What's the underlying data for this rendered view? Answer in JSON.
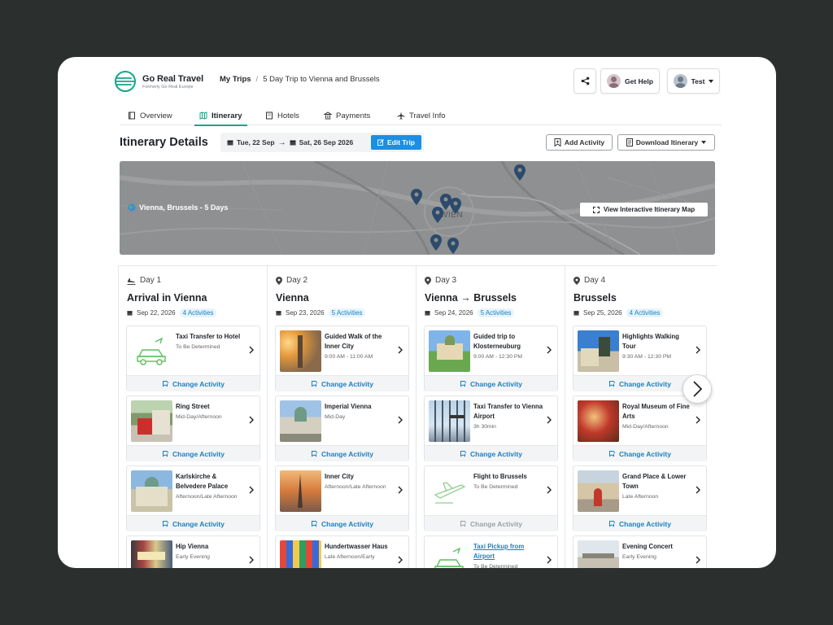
{
  "brand": {
    "name": "Go Real Travel",
    "tagline": "Formerly Go Real Europe",
    "accent": "#17a589"
  },
  "breadcrumb": {
    "root": "My Trips",
    "separator": "/",
    "current": "5 Day Trip to Vienna and Brussels"
  },
  "header": {
    "help_label": "Get Help",
    "user_label": "Test"
  },
  "tabs": [
    {
      "label": "Overview",
      "icon": "book-icon"
    },
    {
      "label": "Itinerary",
      "icon": "map-icon",
      "active": true
    },
    {
      "label": "Hotels",
      "icon": "building-icon"
    },
    {
      "label": "Payments",
      "icon": "bank-icon"
    },
    {
      "label": "Travel Info",
      "icon": "plane-icon"
    }
  ],
  "itinerary": {
    "title": "Itinerary Details",
    "start_date": "Tue, 22 Sep",
    "end_date": "Sat, 26 Sep 2026",
    "edit_label": "Edit Trip",
    "add_label": "Add Activity",
    "download_label": "Download Itinerary"
  },
  "map": {
    "label": "Vienna, Brussels - 5 Days",
    "city_text": "WIEN",
    "button_label": "View Interactive Itinerary Map"
  },
  "change_label": "Change Activity",
  "days": [
    {
      "day": "Day 1",
      "title": "Arrival in Vienna",
      "date": "Sep 22, 2026",
      "count": "4 Activities",
      "activities": [
        {
          "name": "Taxi Transfer to Hotel",
          "time": "To Be Determined",
          "thumb": "car-icon"
        },
        {
          "name": "Ring Street",
          "time": "Mid-Day/Afternoon",
          "thumb": "tram-photo"
        },
        {
          "name": "Karlskirche & Belvedere Palace",
          "time": "Afternoon/Late Afternoon",
          "thumb": "church-photo"
        },
        {
          "name": "Hip Vienna",
          "time": "Early Evening",
          "thumb": "street-photo"
        }
      ]
    },
    {
      "day": "Day 2",
      "title": "Vienna",
      "date": "Sep 23, 2026",
      "count": "5 Activities",
      "activities": [
        {
          "name": "Guided Walk of the Inner City",
          "time": "9:00 AM - 11:00 AM",
          "thumb": "city-photo"
        },
        {
          "name": "Imperial Vienna",
          "time": "Mid-Day",
          "thumb": "palace-photo"
        },
        {
          "name": "Inner City",
          "time": "Afternoon/Late Afternoon",
          "thumb": "cathedral-photo"
        },
        {
          "name": "Hundertwasser Haus",
          "time": "Late Afternoon/Early",
          "thumb": "colorful-photo"
        }
      ]
    },
    {
      "day": "Day 3",
      "title": "Vienna → Brussels",
      "date": "Sep 24, 2026",
      "count": "5 Activities",
      "activities": [
        {
          "name": "Guided trip to Klosterneuburg",
          "time": "9:00 AM - 12:30 PM",
          "thumb": "abbey-photo"
        },
        {
          "name": "Taxi Transfer to Vienna Airport",
          "time": "3h 30min",
          "thumb": "airport-photo"
        },
        {
          "name": "Flight to Brussels",
          "time": "To Be Determined",
          "thumb": "plane-icon",
          "disabled": true
        },
        {
          "name": "Taxi Pickup from Airport",
          "time": "To Be Determined",
          "thumb": "car-icon",
          "link": true
        }
      ]
    },
    {
      "day": "Day 4",
      "title": "Brussels",
      "date": "Sep 25, 2026",
      "count": "4 Activities",
      "activities": [
        {
          "name": "Highlights Walking Tour",
          "time": "9:30 AM - 12:30 PM",
          "thumb": "statue-photo"
        },
        {
          "name": "Royal Museum of Fine Arts",
          "time": "Mid-Day/Afternoon",
          "thumb": "painting-photo"
        },
        {
          "name": "Grand Place & Lower Town",
          "time": "Late Afternoon",
          "thumb": "square-photo"
        },
        {
          "name": "Evening Concert",
          "time": "Early Evening",
          "thumb": "opera-photo"
        }
      ]
    }
  ]
}
